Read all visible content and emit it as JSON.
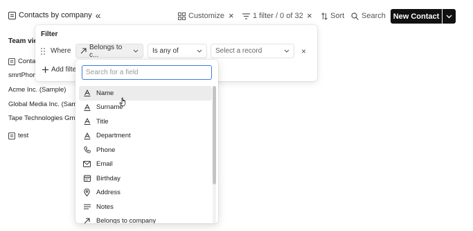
{
  "header": {
    "title": "Contacts by company",
    "collapse_glyph": "«",
    "customize_label": "Customize",
    "filter_label": "1 filter / 0 of 32",
    "sort_label": "Sort",
    "search_label": "Search",
    "new_contact_label": "New Contact"
  },
  "sidebar": {
    "team_views_label": "Team vie",
    "rows": [
      {
        "label": "Contac",
        "icon": "view-icon"
      },
      {
        "label": "smrtPhon",
        "icon": ""
      },
      {
        "label": "Acme Inc. (Sample)",
        "icon": ""
      },
      {
        "label": "Global Media Inc. (Sam",
        "icon": ""
      },
      {
        "label": "Tape Technologies Gm",
        "icon": ""
      },
      {
        "label": "test",
        "icon": "view-icon"
      }
    ]
  },
  "filter": {
    "heading": "Filter",
    "where_label": "Where",
    "field_select": "Belongs to c...",
    "operator_select": "Is any of",
    "value_placeholder": "Select a record",
    "add_filter_label": "Add filte"
  },
  "field_picker": {
    "search_placeholder": "Search for a field",
    "options": [
      {
        "label": "Name",
        "icon": "text-icon",
        "hover": true
      },
      {
        "label": "Surname",
        "icon": "text-icon"
      },
      {
        "label": "Title",
        "icon": "text-icon"
      },
      {
        "label": "Department",
        "icon": "text-icon"
      },
      {
        "label": "Phone",
        "icon": "phone-icon"
      },
      {
        "label": "Email",
        "icon": "email-icon"
      },
      {
        "label": "Birthday",
        "icon": "calendar-icon"
      },
      {
        "label": "Address",
        "icon": "location-icon"
      },
      {
        "label": "Notes",
        "icon": "notes-icon"
      },
      {
        "label": "Belongs to company",
        "icon": "relation-icon"
      }
    ]
  }
}
